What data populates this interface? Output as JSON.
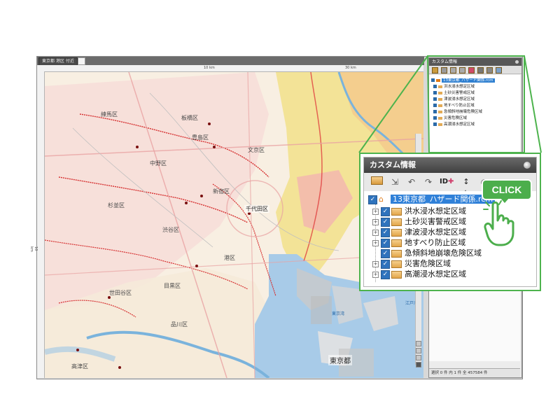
{
  "app": {
    "doc_tab": "東京都 港区 付近"
  },
  "ruler": {
    "top_labels": [
      "10 km",
      "30 km"
    ],
    "left_label": "10 km"
  },
  "map": {
    "labels": [
      {
        "text": "練馬区",
        "style": "normal"
      },
      {
        "text": "豊島区",
        "style": "normal"
      },
      {
        "text": "板橋区",
        "style": "normal"
      },
      {
        "text": "中野区",
        "style": "normal"
      },
      {
        "text": "文京区",
        "style": "normal"
      },
      {
        "text": "新宿区",
        "style": "normal"
      },
      {
        "text": "千代田区",
        "style": "big"
      },
      {
        "text": "杉並区",
        "style": "normal"
      },
      {
        "text": "渋谷区",
        "style": "normal"
      },
      {
        "text": "港区",
        "style": "normal"
      },
      {
        "text": "世田谷区",
        "style": "normal"
      },
      {
        "text": "目黒区",
        "style": "normal"
      },
      {
        "text": "品川区",
        "style": "normal"
      },
      {
        "text": "高津区",
        "style": "normal"
      },
      {
        "text": "東京都",
        "style": "big"
      },
      {
        "text": "東京湾",
        "style": "blue"
      },
      {
        "text": "江戸川",
        "style": "blue"
      }
    ]
  },
  "side_panel": {
    "title": "カスタム情報",
    "root": "13東京都_ハザード関係.rcm",
    "items": [
      "洪水浸水想定区域",
      "土砂災害警戒区域",
      "津波浸水想定区域",
      "地すべり防止区域",
      "急傾斜地崩壊危険区域",
      "災害危険区域",
      "高潮浸水想定区域"
    ],
    "status": "選択 0 件  内 1 件  全 457584 件"
  },
  "zoom_panel": {
    "title": "カスタム情報",
    "toolbar_icons": [
      "folder-icon",
      "import-icon",
      "undo-icon",
      "redo-icon",
      "id-add-icon",
      "name-label-icon",
      "search-icon"
    ],
    "toolbar_id_text": "ID",
    "toolbar_name_text": "名",
    "root": "13東京都_ハザード関係.rcm",
    "items": [
      {
        "label": "洪水浸水想定区域",
        "expander": "+"
      },
      {
        "label": "土砂災害警戒区域",
        "expander": "+"
      },
      {
        "label": "津波浸水想定区域",
        "expander": "+"
      },
      {
        "label": "地すべり防止区域",
        "expander": "+"
      },
      {
        "label": "急傾斜地崩壊危険区域",
        "expander": ""
      },
      {
        "label": "災害危険区域",
        "expander": "+"
      },
      {
        "label": "高潮浸水想定区域",
        "expander": "+"
      }
    ]
  },
  "callout": {
    "click_label": "CLICK"
  },
  "colors": {
    "accent_green": "#4db34d",
    "selection_blue": "#2f80d8",
    "folder_orange": "#e3a64a",
    "flood_red": "#d63030",
    "flood_yellow": "#f2e08a",
    "flood_pink": "#f7c9c9",
    "water_blue": "#a8cbe8"
  }
}
